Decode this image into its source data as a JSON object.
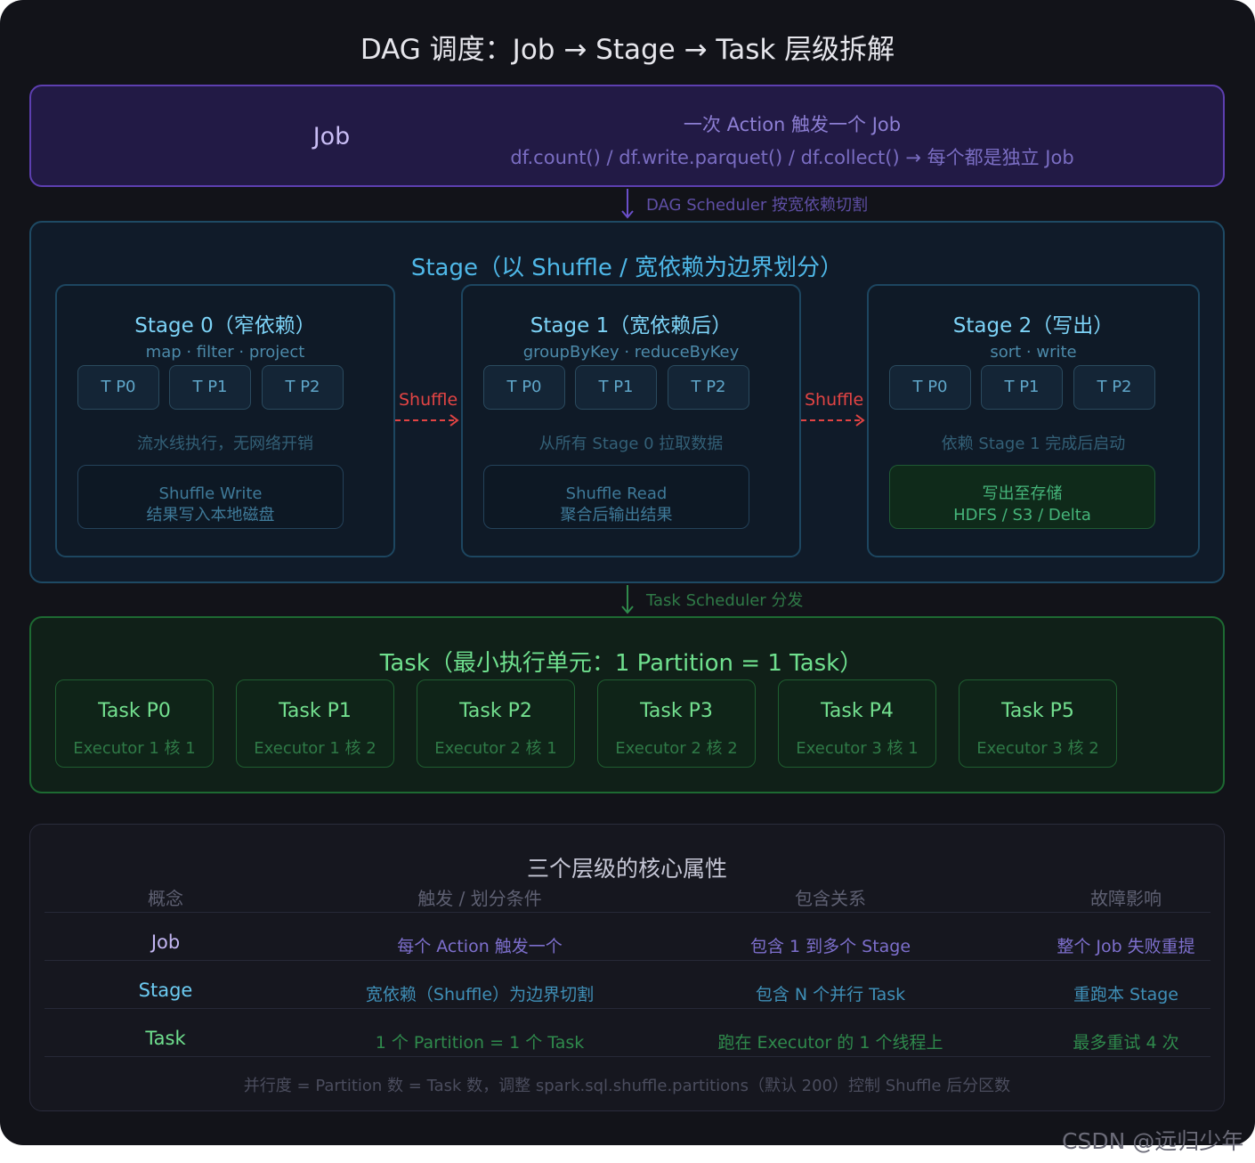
{
  "title": "DAG 调度：Job → Stage → Task 层级拆解",
  "job": {
    "label": "Job",
    "description": "一次 Action 触发一个 Job",
    "example": "df.count() / df.write.parquet() / df.collect() → 每个都是独立 Job"
  },
  "connectors": {
    "dag_scheduler": "DAG Scheduler 按宽依赖切割",
    "task_scheduler": "Task Scheduler 分发"
  },
  "stage_section": {
    "title": "Stage（以 Shuffle / 宽依赖为边界划分）",
    "shuffle_label": "Shuffle",
    "stages": [
      {
        "title": "Stage 0（窄依赖）",
        "ops": "map · filter · project",
        "tasks": [
          "T P0",
          "T P1",
          "T P2"
        ],
        "note": "流水线执行，无网络开销",
        "sub_line1": "Shuffle Write",
        "sub_line2": "结果写入本地磁盘"
      },
      {
        "title": "Stage 1（宽依赖后）",
        "ops": "groupByKey · reduceByKey",
        "tasks": [
          "T P0",
          "T P1",
          "T P2"
        ],
        "note": "从所有 Stage 0 拉取数据",
        "sub_line1": "Shuffle Read",
        "sub_line2": "聚合后输出结果"
      },
      {
        "title": "Stage 2（写出）",
        "ops": "sort · write",
        "tasks": [
          "T P0",
          "T P1",
          "T P2"
        ],
        "note": "依赖 Stage 1 完成后启动",
        "sub_line1": "写出至存储",
        "sub_line2": "HDFS / S3 / Delta"
      }
    ]
  },
  "task_section": {
    "title": "Task（最小执行单元：1 Partition = 1 Task）",
    "tasks": [
      {
        "name": "Task P0",
        "executor": "Executor 1 核 1"
      },
      {
        "name": "Task P1",
        "executor": "Executor 1 核 2"
      },
      {
        "name": "Task P2",
        "executor": "Executor 2 核 1"
      },
      {
        "name": "Task P3",
        "executor": "Executor 2 核 2"
      },
      {
        "name": "Task P4",
        "executor": "Executor 3 核 1"
      },
      {
        "name": "Task P5",
        "executor": "Executor 3 核 2"
      }
    ]
  },
  "properties_table": {
    "title": "三个层级的核心属性",
    "headers": [
      "概念",
      "触发 / 划分条件",
      "包含关系",
      "故障影响"
    ],
    "rows": [
      [
        "Job",
        "每个 Action 触发一个",
        "包含 1 到多个 Stage",
        "整个 Job 失败重提"
      ],
      [
        "Stage",
        "宽依赖（Shuffle）为边界切割",
        "包含 N 个并行 Task",
        "重跑本 Stage"
      ],
      [
        "Task",
        "1 个 Partition = 1 个 Task",
        "跑在 Executor 的 1 个线程上",
        "最多重试 4 次"
      ]
    ],
    "footnote": "并行度 = Partition 数 = Task 数，调整 spark.sql.shuffle.partitions（默认 200）控制 Shuffle 后分区数"
  },
  "watermark": "CSDN @远归少年",
  "colors": {
    "background": "#121319",
    "job_accent": "#8d7fd4",
    "stage_accent": "#4fb8e8",
    "task_accent": "#6fe08e",
    "shuffle_arrow": "#e24444"
  }
}
